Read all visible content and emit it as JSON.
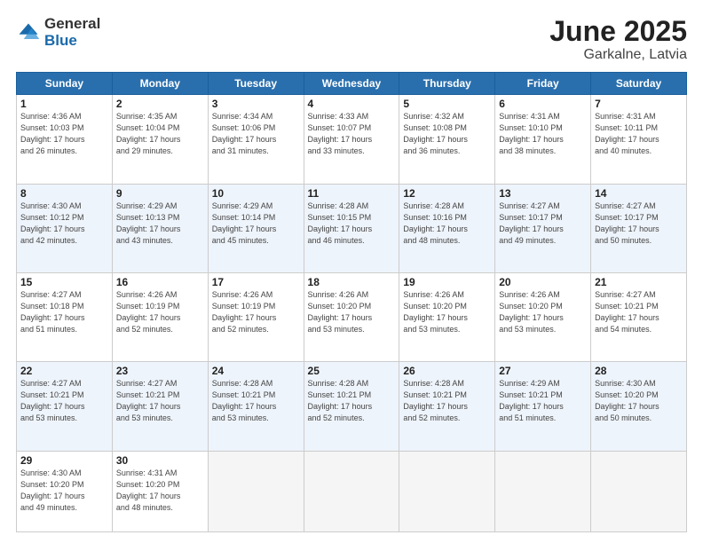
{
  "logo": {
    "general": "General",
    "blue": "Blue"
  },
  "header": {
    "month_year": "June 2025",
    "location": "Garkalne, Latvia"
  },
  "days_of_week": [
    "Sunday",
    "Monday",
    "Tuesday",
    "Wednesday",
    "Thursday",
    "Friday",
    "Saturday"
  ],
  "weeks": [
    [
      {
        "day": "1",
        "sunrise": "4:36 AM",
        "sunset": "10:03 PM",
        "daylight": "17 hours and 26 minutes."
      },
      {
        "day": "2",
        "sunrise": "4:35 AM",
        "sunset": "10:04 PM",
        "daylight": "17 hours and 29 minutes."
      },
      {
        "day": "3",
        "sunrise": "4:34 AM",
        "sunset": "10:06 PM",
        "daylight": "17 hours and 31 minutes."
      },
      {
        "day": "4",
        "sunrise": "4:33 AM",
        "sunset": "10:07 PM",
        "daylight": "17 hours and 33 minutes."
      },
      {
        "day": "5",
        "sunrise": "4:32 AM",
        "sunset": "10:08 PM",
        "daylight": "17 hours and 36 minutes."
      },
      {
        "day": "6",
        "sunrise": "4:31 AM",
        "sunset": "10:10 PM",
        "daylight": "17 hours and 38 minutes."
      },
      {
        "day": "7",
        "sunrise": "4:31 AM",
        "sunset": "10:11 PM",
        "daylight": "17 hours and 40 minutes."
      }
    ],
    [
      {
        "day": "8",
        "sunrise": "4:30 AM",
        "sunset": "10:12 PM",
        "daylight": "17 hours and 42 minutes."
      },
      {
        "day": "9",
        "sunrise": "4:29 AM",
        "sunset": "10:13 PM",
        "daylight": "17 hours and 43 minutes."
      },
      {
        "day": "10",
        "sunrise": "4:29 AM",
        "sunset": "10:14 PM",
        "daylight": "17 hours and 45 minutes."
      },
      {
        "day": "11",
        "sunrise": "4:28 AM",
        "sunset": "10:15 PM",
        "daylight": "17 hours and 46 minutes."
      },
      {
        "day": "12",
        "sunrise": "4:28 AM",
        "sunset": "10:16 PM",
        "daylight": "17 hours and 48 minutes."
      },
      {
        "day": "13",
        "sunrise": "4:27 AM",
        "sunset": "10:17 PM",
        "daylight": "17 hours and 49 minutes."
      },
      {
        "day": "14",
        "sunrise": "4:27 AM",
        "sunset": "10:17 PM",
        "daylight": "17 hours and 50 minutes."
      }
    ],
    [
      {
        "day": "15",
        "sunrise": "4:27 AM",
        "sunset": "10:18 PM",
        "daylight": "17 hours and 51 minutes."
      },
      {
        "day": "16",
        "sunrise": "4:26 AM",
        "sunset": "10:19 PM",
        "daylight": "17 hours and 52 minutes."
      },
      {
        "day": "17",
        "sunrise": "4:26 AM",
        "sunset": "10:19 PM",
        "daylight": "17 hours and 52 minutes."
      },
      {
        "day": "18",
        "sunrise": "4:26 AM",
        "sunset": "10:20 PM",
        "daylight": "17 hours and 53 minutes."
      },
      {
        "day": "19",
        "sunrise": "4:26 AM",
        "sunset": "10:20 PM",
        "daylight": "17 hours and 53 minutes."
      },
      {
        "day": "20",
        "sunrise": "4:26 AM",
        "sunset": "10:20 PM",
        "daylight": "17 hours and 53 minutes."
      },
      {
        "day": "21",
        "sunrise": "4:27 AM",
        "sunset": "10:21 PM",
        "daylight": "17 hours and 54 minutes."
      }
    ],
    [
      {
        "day": "22",
        "sunrise": "4:27 AM",
        "sunset": "10:21 PM",
        "daylight": "17 hours and 53 minutes."
      },
      {
        "day": "23",
        "sunrise": "4:27 AM",
        "sunset": "10:21 PM",
        "daylight": "17 hours and 53 minutes."
      },
      {
        "day": "24",
        "sunrise": "4:28 AM",
        "sunset": "10:21 PM",
        "daylight": "17 hours and 53 minutes."
      },
      {
        "day": "25",
        "sunrise": "4:28 AM",
        "sunset": "10:21 PM",
        "daylight": "17 hours and 52 minutes."
      },
      {
        "day": "26",
        "sunrise": "4:28 AM",
        "sunset": "10:21 PM",
        "daylight": "17 hours and 52 minutes."
      },
      {
        "day": "27",
        "sunrise": "4:29 AM",
        "sunset": "10:21 PM",
        "daylight": "17 hours and 51 minutes."
      },
      {
        "day": "28",
        "sunrise": "4:30 AM",
        "sunset": "10:20 PM",
        "daylight": "17 hours and 50 minutes."
      }
    ],
    [
      {
        "day": "29",
        "sunrise": "4:30 AM",
        "sunset": "10:20 PM",
        "daylight": "17 hours and 49 minutes."
      },
      {
        "day": "30",
        "sunrise": "4:31 AM",
        "sunset": "10:20 PM",
        "daylight": "17 hours and 48 minutes."
      },
      null,
      null,
      null,
      null,
      null
    ]
  ]
}
